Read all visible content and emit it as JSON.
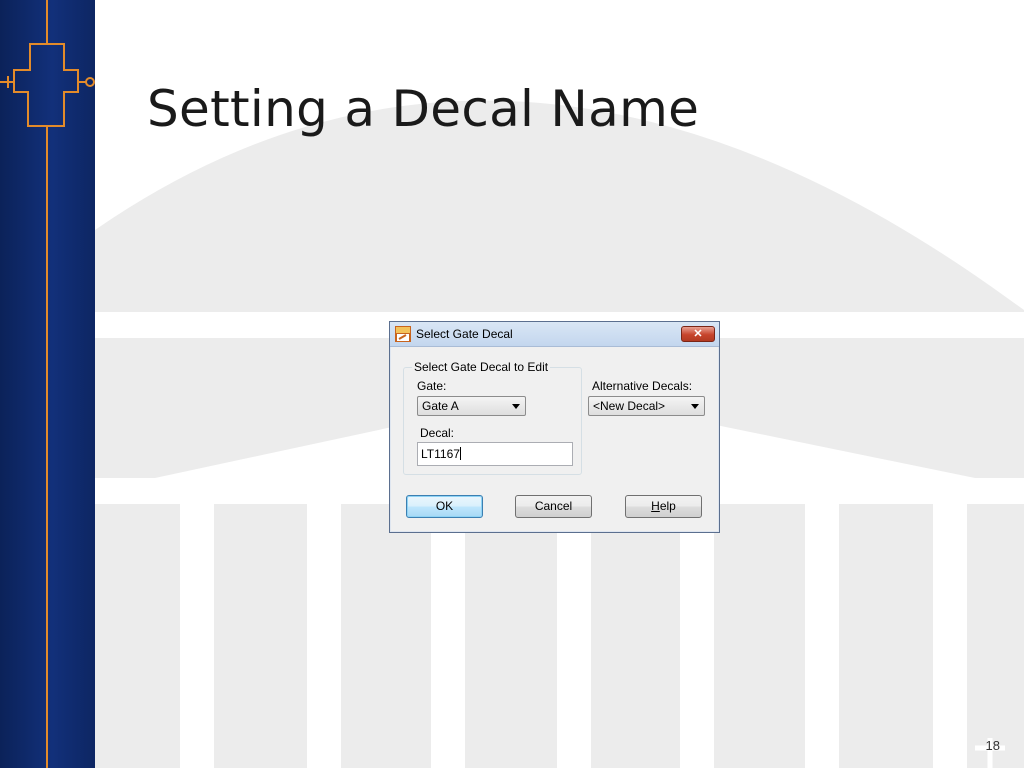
{
  "slide": {
    "title": "Setting a Decal Name",
    "page_number": "18"
  },
  "dialog": {
    "title": "Select Gate Decal",
    "close_symbol": "✕",
    "group_label": "Select Gate Decal to Edit",
    "gate_label": "Gate:",
    "gate_value": "Gate A",
    "decal_label": "Decal:",
    "decal_value": "LT1167",
    "alt_label": "Alternative Decals:",
    "alt_value": "<New Decal>",
    "buttons": {
      "ok": "OK",
      "cancel": "Cancel",
      "help": "Help"
    }
  },
  "colors": {
    "sidebar": "#0e2a66",
    "circuit_accent": "#e38b2a",
    "background_art": "#ececec"
  },
  "icons": [
    "pads-app-icon",
    "close-icon",
    "dropdown-arrow-icon",
    "circuit-symbol-icon"
  ]
}
